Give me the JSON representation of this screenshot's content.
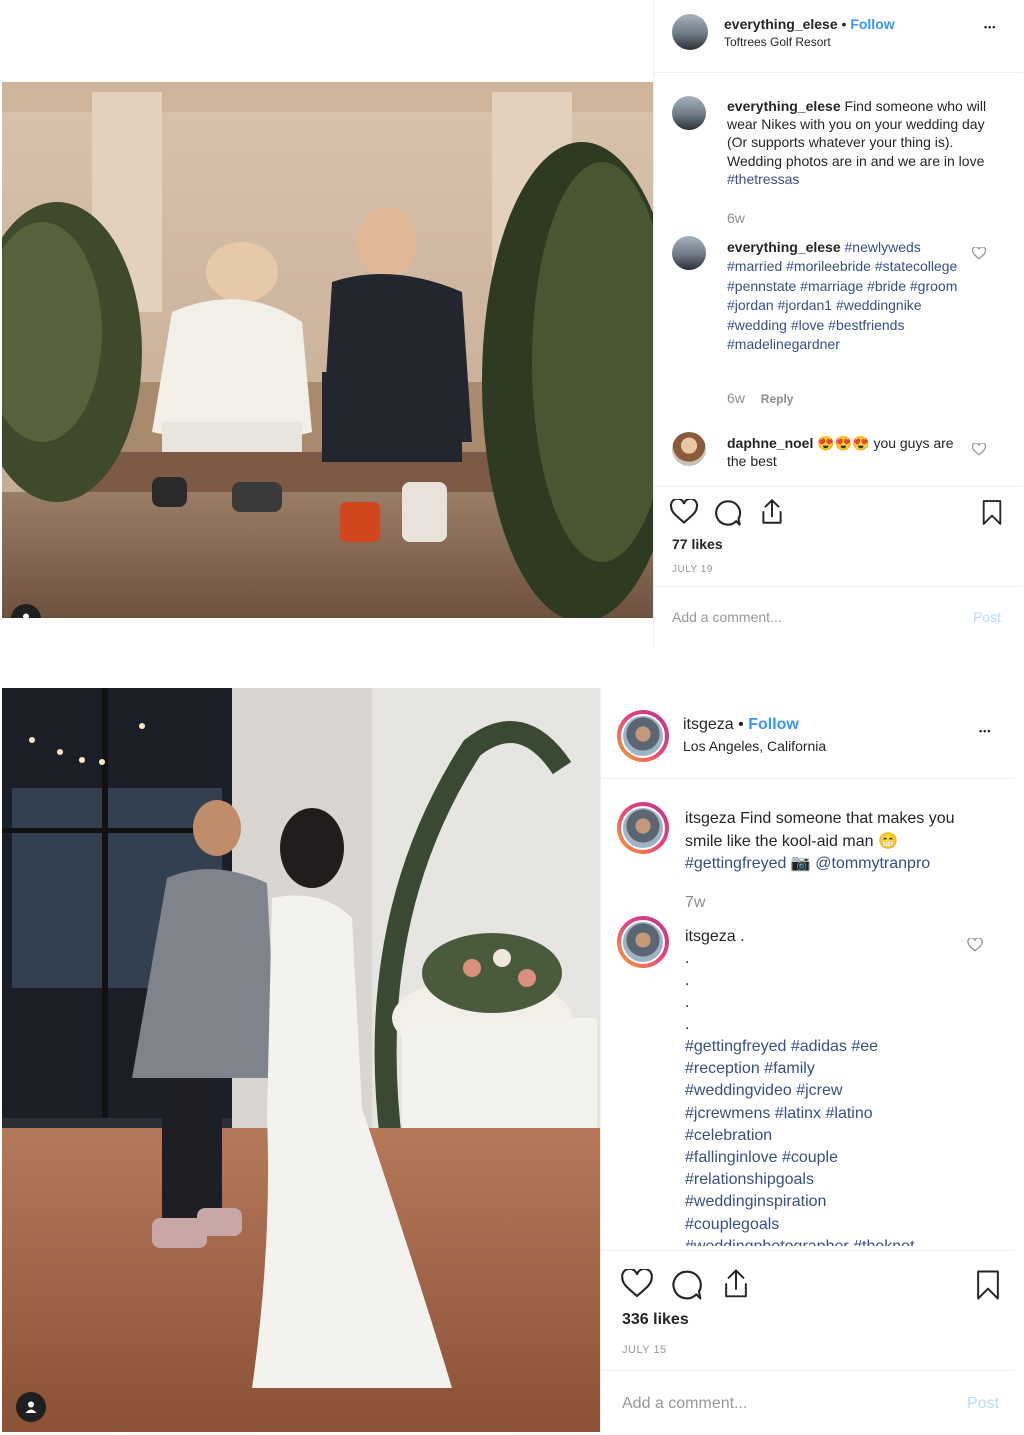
{
  "post1": {
    "user": "everything_elese",
    "separator": "•",
    "follow": "Follow",
    "location": "Toftrees Golf Resort",
    "more": "•••",
    "caption": {
      "user": "everything_elese",
      "text": "Find someone who will wear Nikes with you on your wedding day (Or supports whatever your thing is). Wedding photos are in and we are in love",
      "tag": "#thetressas",
      "time": "6w"
    },
    "comment1": {
      "user": "everything_elese",
      "tags": "#newlyweds #married #morileebride #statecollege #pennstate #marriage #bride #groom #jordan #jordan1 #weddingnike #wedding #love #bestfriends #madelinegardner",
      "time": "6w",
      "reply": "Reply"
    },
    "comment2": {
      "user": "daphne_noel",
      "emoji": "😍😍😍",
      "text": "you guys are the best"
    },
    "likes": "77 likes",
    "date": "JULY 19",
    "add_comment_placeholder": "Add a comment...",
    "post_label": "Post"
  },
  "post2": {
    "user": "itsgeza",
    "separator": "•",
    "follow": "Follow",
    "location": "Los Angeles, California",
    "more": "•••",
    "caption": {
      "user": "itsgeza",
      "text": "Find someone that makes you smile like the kool-aid man 😁",
      "tag": "#gettingfreyed",
      "camera": "📷",
      "mention": "@tommytranpro",
      "time": "7w"
    },
    "comment1": {
      "user": "itsgeza",
      "text": ".",
      "dots": [
        ".",
        ".",
        ".",
        "."
      ],
      "tags": [
        "#gettingfreyed #adidas #ee",
        "#reception #family",
        "#weddingvideo #jcrew",
        "#jcrewmens #latinx #latino",
        "#celebration",
        "#fallinginlove #couple",
        "#relationshipgoals",
        "#weddinginspiration",
        "#couplegoals",
        "#weddingphotographer #theknot"
      ]
    },
    "likes": "336 likes",
    "date": "JULY 15",
    "add_comment_placeholder": "Add a comment...",
    "post_label": "Post"
  },
  "icons": [
    "heart-icon",
    "comment-icon",
    "share-icon",
    "bookmark-icon",
    "user-silhouette-icon",
    "more-options-icon"
  ],
  "colors": {
    "link": "#385185",
    "follow": "#3897f0",
    "muted": "#8e8e8e",
    "post_disabled": "#b2dffc"
  }
}
